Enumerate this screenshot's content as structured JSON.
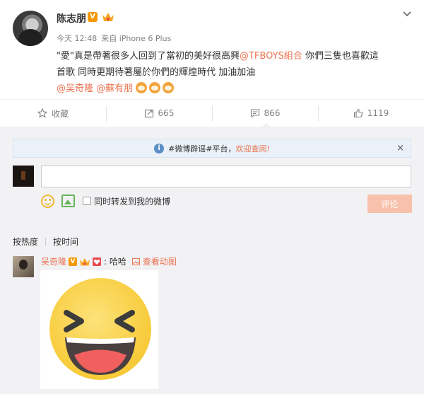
{
  "post": {
    "username": "陈志朋",
    "v_badge": "V",
    "time": "今天 12:48",
    "source": "来自 iPhone 6 Plus",
    "content_line1_start": "\"愛\"真是帶著很多人回到了當初的美好很高興",
    "mention_tfboys": "@TFBOYS組合",
    "content_line1_end": " 你們三隻也喜歡這",
    "content_line2": "首歌 同時更期待著屬於你們的輝煌時代 加油加油",
    "mention_1": "@吴奇隆",
    "mention_2": "@蘇有朋",
    "emoji_names": [
      "tiger-emoji",
      "tiger-emoji",
      "tiger-emoji"
    ]
  },
  "actions": {
    "favorite_label": "收藏",
    "repost_count": "665",
    "comment_count": "866",
    "like_count": "1119"
  },
  "notice": {
    "text_prefix": "#微博辟谣#平台，",
    "text_highlight": "欢迎查阅!",
    "close": "×"
  },
  "composer": {
    "repost_option": "同时转发到我的微博",
    "submit_label": "评论"
  },
  "sort": {
    "hot": "按热度",
    "time": "按时间"
  },
  "comment": {
    "username": "吴奇隆",
    "v_badge": "V",
    "text": ": 哈哈",
    "view_gif": "查看动图",
    "gif_emoji": "laughing-face-emoji"
  },
  "colors": {
    "accent": "#eb7350",
    "vip": "#f39800",
    "background": "#f2f2f5",
    "emoji_yellow": "#fbd64f"
  }
}
